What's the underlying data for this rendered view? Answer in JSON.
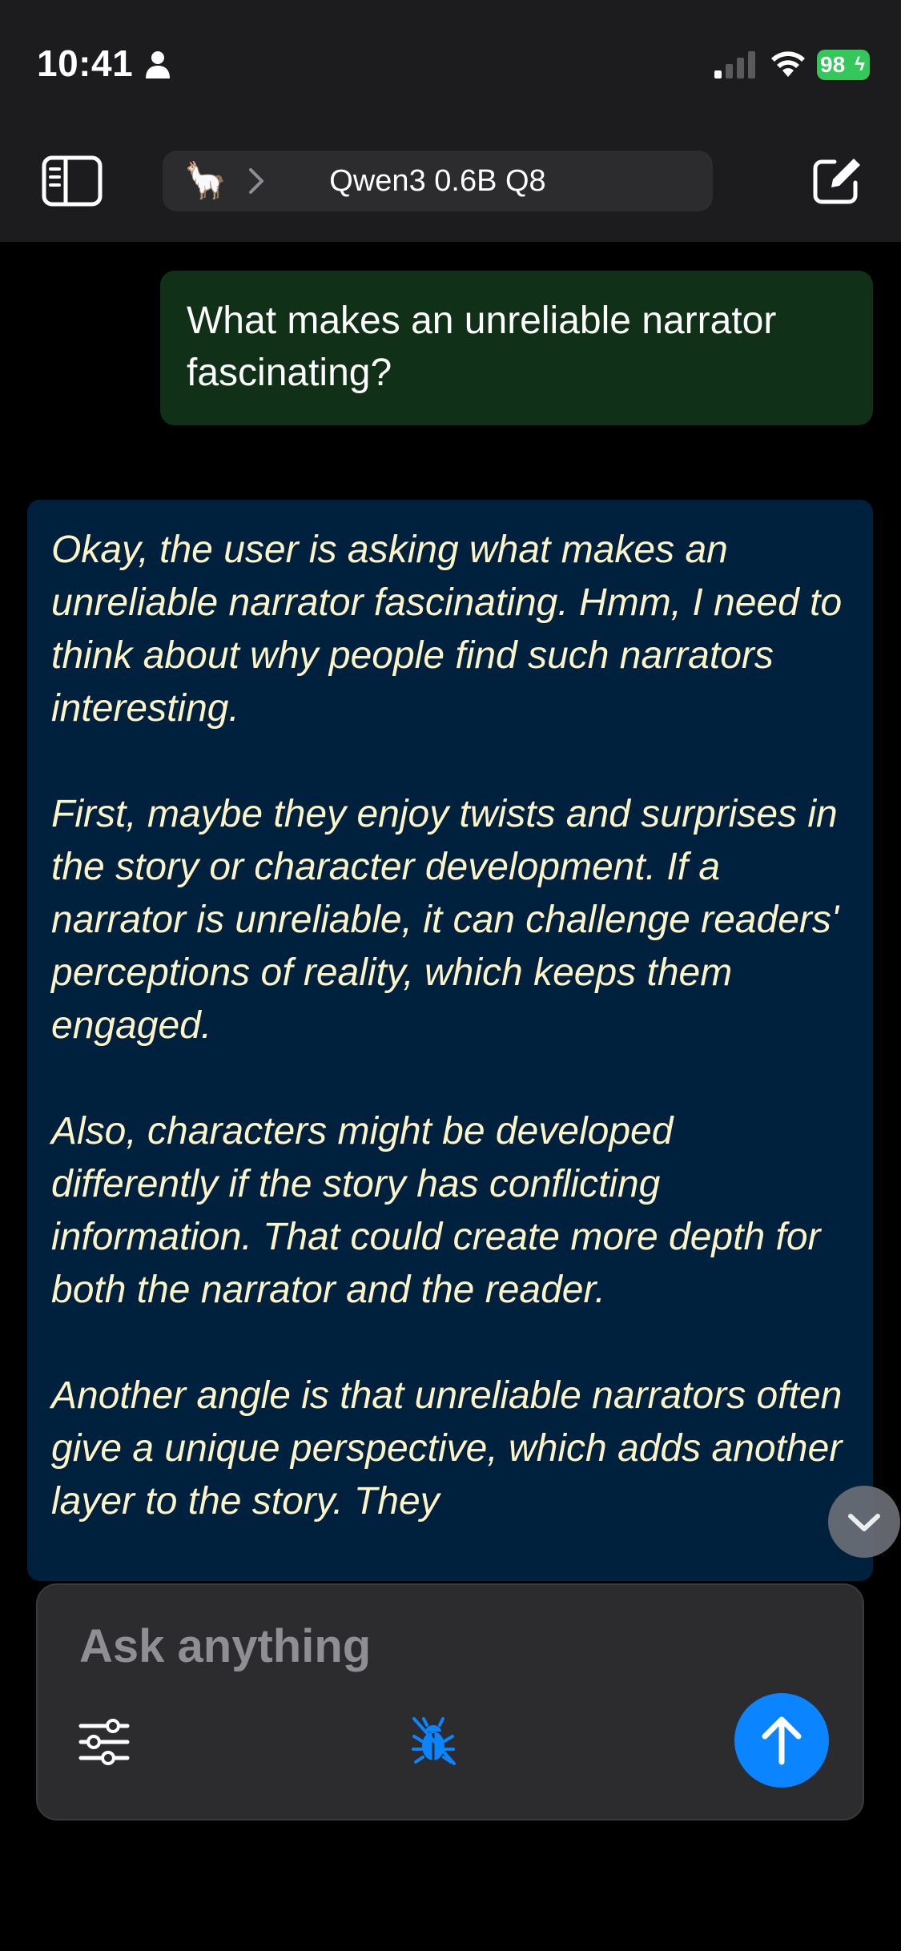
{
  "status_bar": {
    "time": "10:41",
    "battery_level": "98",
    "battery_icon": "charging-bolt"
  },
  "nav": {
    "sidebar_icon": "sidebar-toggle-icon",
    "model_emoji": "🦙",
    "model_name": "Qwen3 0.6B Q8",
    "compose_icon": "new-chat-icon"
  },
  "messages": {
    "user": {
      "text": "What makes an unreliable narrator fascinating?"
    },
    "assistant": {
      "paragraphs": [
        "Okay, the user is asking what makes an unreliable narrator fascinating. Hmm, I need to think about why people find such narrators interesting.",
        "First, maybe they enjoy twists and surprises in the story or character development. If a narrator is unreliable, it can challenge readers' perceptions of reality, which keeps them engaged.",
        "Also, characters might be developed differently if the story has conflicting information. That could create more depth for both the narrator and the reader.",
        "Another angle is that unreliable narrators often give a unique perspective, which adds another layer to the story. They"
      ]
    }
  },
  "composer": {
    "placeholder": "Ask anything",
    "value": "",
    "settings_icon": "sliders-icon",
    "debug_icon": "bug-icon",
    "send_icon": "arrow-up-icon"
  },
  "colors": {
    "user_bubble": "#103118",
    "assistant_bubble": "#00213e",
    "assistant_text": "#fcf3c6",
    "accent": "#0a84ff",
    "battery": "#34c759"
  }
}
